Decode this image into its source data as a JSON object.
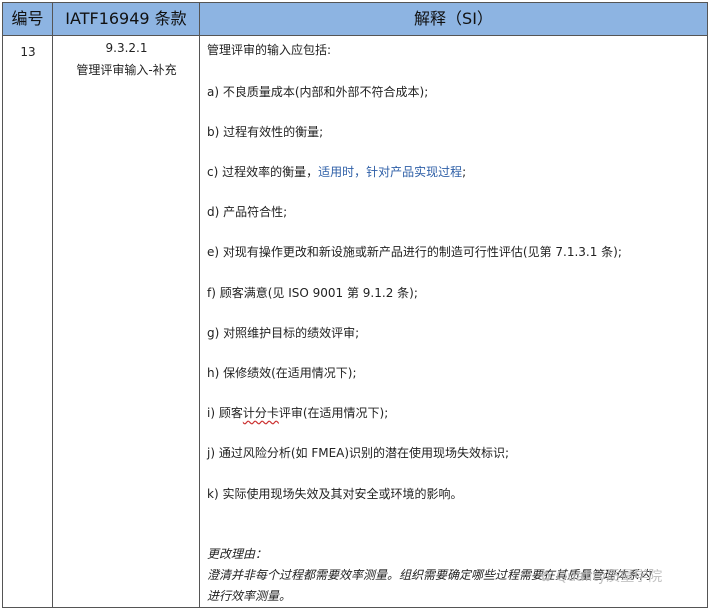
{
  "header": {
    "col_no": "编号",
    "col_clause": "IATF16949 条款",
    "col_si": "解释（SI）"
  },
  "row": {
    "no": "13",
    "clause_number": "9.3.2.1",
    "clause_title": "管理评审输入-补充",
    "intro": "管理评审的输入应包括:",
    "items": [
      "a)  不良质量成本(内部和外部不符合成本);",
      "b)  过程有效性的衡量;",
      "c)  过程效率的衡量，",
      "d)  产品符合性;",
      "e)  对现有操作更改和新设施或新产品进行的制造可行性评估(见第  7.1.3.1  条);",
      "f)  顾客满意(见  ISO 9001  第  9.1.2  条);",
      "g)  对照维护目标的绩效评审;",
      "h)  保修绩效(在适用情况下);",
      "i)  顾客",
      "j)  通过风险分析(如  FMEA)识别的潜在使用现场失效标识;",
      "k)  实际使用现场失效及其对安全或环境的影响。"
    ],
    "item_c_highlight": "适用时，针对产品实现过程",
    "item_c_tail": ";",
    "item_i_underlined": "计分卡",
    "item_i_tail": "评审(在适用情况下);",
    "change_reason_title": "更改理由：",
    "change_reason_line1": "澄清并非每个过程都需要效率测量。组织需要确定哪些过程需要在其质量管理体系内",
    "change_reason_line2": "进行效率测量。"
  },
  "watermark": "Quality质量学院"
}
